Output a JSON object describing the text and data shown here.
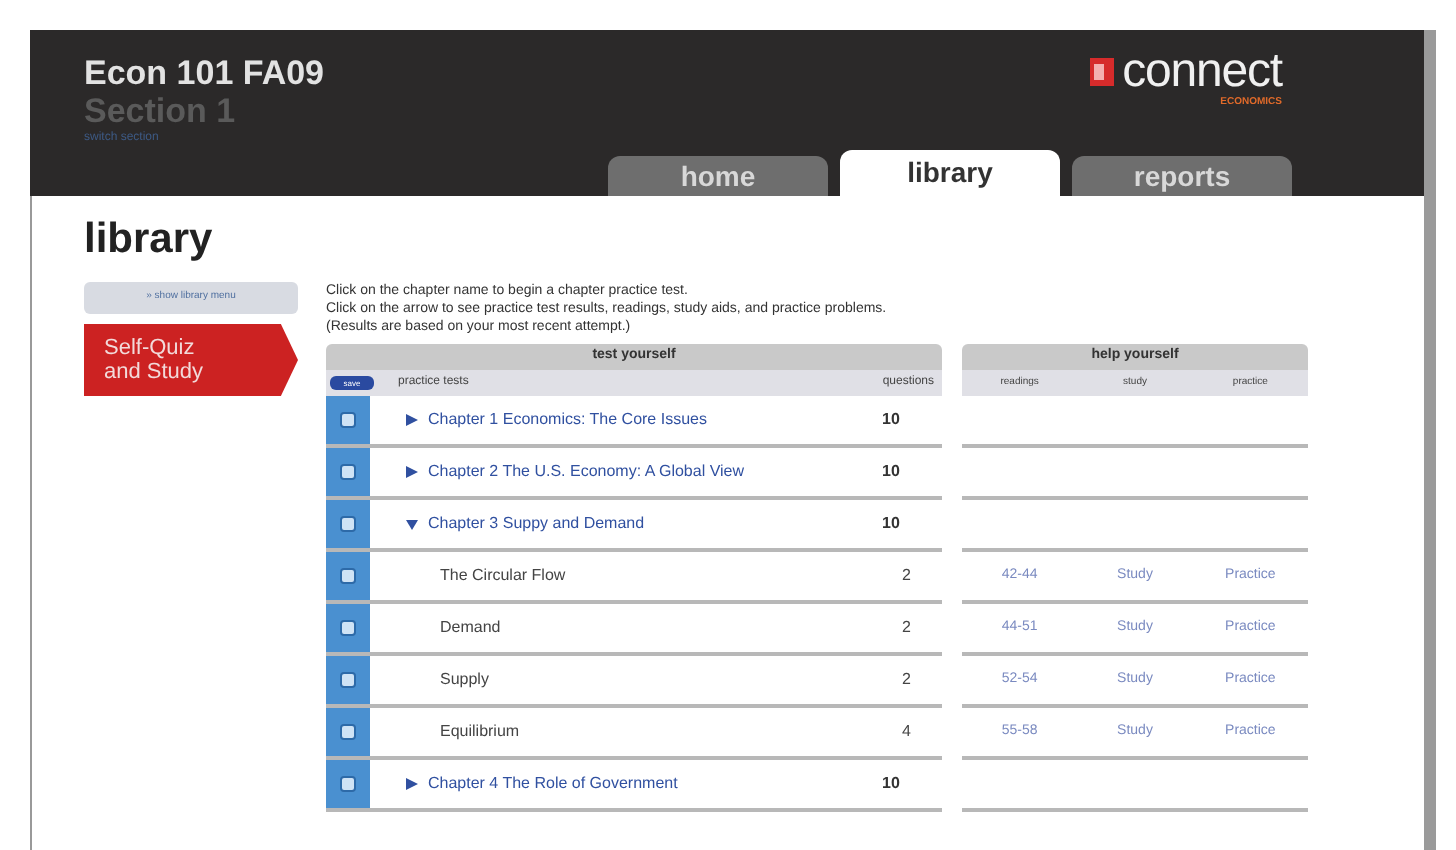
{
  "header": {
    "course": "Econ 101 FA09",
    "section": "Section 1",
    "switch_link": "switch section"
  },
  "logo": {
    "name": "connect",
    "subtitle": "ECONOMICS"
  },
  "tabs": [
    {
      "label": "home",
      "selected": false
    },
    {
      "label": "library",
      "selected": true
    },
    {
      "label": "reports",
      "selected": false
    }
  ],
  "page_title": "library",
  "sidebar": {
    "menu_link": "» show library menu",
    "items": [
      {
        "label": "Self-Quiz and Study",
        "selected": true
      }
    ]
  },
  "instructions": [
    "Click on the chapter name to begin a chapter practice test.",
    "Click on the arrow to see practice test results, readings, study aids, and practice problems.",
    "(Results are based on your most recent attempt.)"
  ],
  "table": {
    "group_headers": [
      "test yourself",
      "help yourself"
    ],
    "save_button": "save",
    "columns": [
      "practice tests",
      "questions",
      "readings",
      "study",
      "practice"
    ],
    "chapters": [
      {
        "title": "Chapter 1 Economics: The Core Issues",
        "questions": "10",
        "expanded": false
      },
      {
        "title": "Chapter 2 The U.S. Economy: A Global View",
        "questions": "10",
        "expanded": false
      },
      {
        "title": "Chapter 3 Suppy and Demand",
        "questions": "10",
        "expanded": true,
        "sections": [
          {
            "title": "The Circular Flow",
            "questions": "2",
            "readings": "42-44",
            "study": "Study",
            "practice": "Practice"
          },
          {
            "title": "Demand",
            "questions": "2",
            "readings": "44-51",
            "study": "Study",
            "practice": "Practice"
          },
          {
            "title": "Supply",
            "questions": "2",
            "readings": "52-54",
            "study": "Study",
            "practice": "Practice"
          },
          {
            "title": "Equilibrium",
            "questions": "4",
            "readings": "55-58",
            "study": "Study",
            "practice": "Practice"
          }
        ]
      },
      {
        "title": "Chapter 4 The Role of Government",
        "questions": "10",
        "expanded": false
      }
    ]
  }
}
